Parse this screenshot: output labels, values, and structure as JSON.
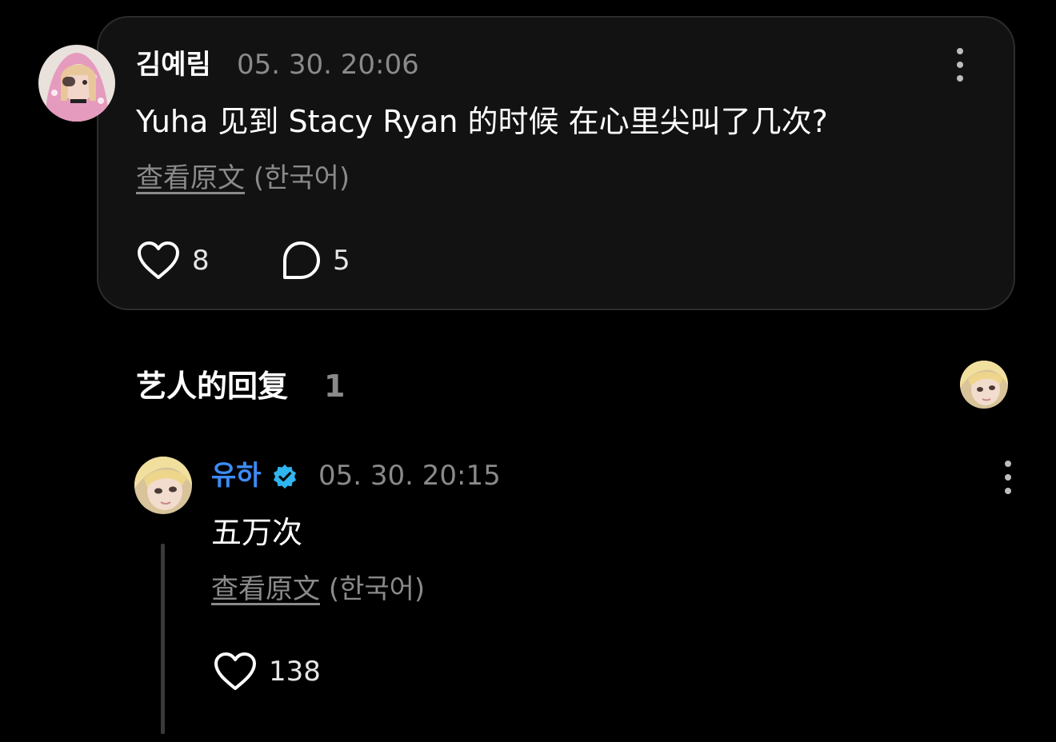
{
  "post": {
    "author": "김예림",
    "timestamp": "05. 30. 20:06",
    "text": "Yuha 见到 Stacy Ryan 的时候 在心里尖叫了几次?",
    "view_original_label": "查看原文",
    "original_language": "(한국어)",
    "likes": "8",
    "comments": "5",
    "more_icon": "more-vertical-icon",
    "like_icon": "heart-outline-icon",
    "comment_icon": "comment-bubble-icon"
  },
  "artist_replies": {
    "title": "艺人的回复",
    "count": "1"
  },
  "reply": {
    "author": "유하",
    "verified": true,
    "verified_icon": "verified-badge-icon",
    "timestamp": "05. 30. 20:15",
    "text": "五万次",
    "view_original_label": "查看原文",
    "original_language": "(한국어)",
    "likes": "138",
    "more_icon": "more-vertical-icon",
    "like_icon": "heart-outline-icon"
  },
  "colors": {
    "background": "#000000",
    "card_background": "#121212",
    "card_border": "#2c2c2c",
    "artist_name": "#3d8bf5",
    "verified_badge": "#2fb5f0",
    "secondary_text": "#8a8a8a"
  }
}
